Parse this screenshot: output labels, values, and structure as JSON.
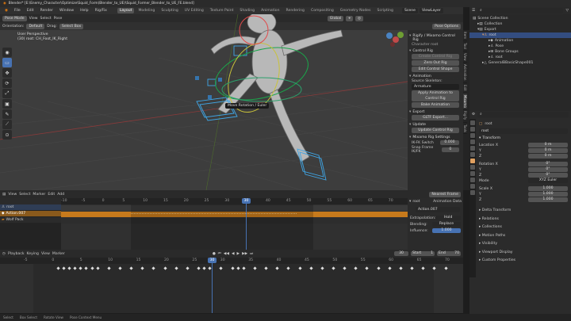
{
  "title_bar": {
    "app_title": "Blender* [E:\\Enemy_Character\\Optimize\\Squid_Form(Blender_to_UE)\\Squid_Former_Blender_to_UE_FE.blend]"
  },
  "menu": [
    "File",
    "Edit",
    "Render",
    "Window",
    "Help",
    "Rig/Fix"
  ],
  "workspaces": [
    {
      "label": "Layout",
      "active": true
    },
    {
      "label": "Modeling",
      "active": false
    },
    {
      "label": "Sculpting",
      "active": false
    },
    {
      "label": "UV Editing",
      "active": false
    },
    {
      "label": "Texture Paint",
      "active": false
    },
    {
      "label": "Shading",
      "active": false
    },
    {
      "label": "Animation",
      "active": false
    },
    {
      "label": "Rendering",
      "active": false
    },
    {
      "label": "Compositing",
      "active": false
    },
    {
      "label": "Geometry Nodes",
      "active": false
    },
    {
      "label": "Scripting",
      "active": false
    }
  ],
  "scene_field": "Scene",
  "viewlayer_field": "ViewLayer",
  "viewport": {
    "mode": "Pose Mode",
    "menus": [
      "View",
      "Select",
      "Pose"
    ],
    "orientation_label": "Orientation:",
    "orientation_value": "Default",
    "drag_label": "Drag:",
    "drag_value": "Select Box",
    "pivot": "Global",
    "pose_options": "Pose Options",
    "overlay_text_1": "User Perspective",
    "overlay_text_2": "(30) root: CH_Foot_IK_Right",
    "tooltip": "Move Rotation / Euler",
    "tool_icons": [
      "◉",
      "▭",
      "✥",
      "⟳",
      "⤢",
      "▣",
      "✎",
      "⟋",
      "⊙"
    ]
  },
  "npanel": {
    "title": "Rigify / Mixamo Control Rig",
    "character_root_label": "Character root",
    "sections": {
      "control_rig": "Control Rig",
      "animation": "Animation",
      "export": "Export",
      "update": "Update",
      "settings": "Mixamo Rig Settings"
    },
    "buttons": {
      "create": "Create Control Rig",
      "zero_out": "Zero Out Rig",
      "edit_shape": "Edit Control Shape",
      "apply_anim": "Apply Animation to Control Rig",
      "bake": "Bake Animation",
      "export": "GLTF Export...",
      "update": "Update Control Rig"
    },
    "source_skeleton_label": "Source Skeleton:",
    "source_skeleton_value": "Armature",
    "ik_fk_label": "IK-FK Switch",
    "ik_fk_value": "0.000",
    "snap_label": "Snap Frame IK/FK",
    "snap_value": "0"
  },
  "side_tabs": [
    "Item",
    "Tool",
    "View",
    "Animation",
    "Edit",
    "Mixamo",
    "Rigify",
    "Tools"
  ],
  "outliner": {
    "header": "Scene Collection",
    "items": [
      {
        "label": "Scene Collection",
        "indent": 0,
        "selected": false
      },
      {
        "label": "Collection",
        "indent": 1,
        "selected": false
      },
      {
        "label": "Export",
        "indent": 1,
        "selected": false
      },
      {
        "label": "root",
        "indent": 2,
        "selected": true
      },
      {
        "label": "Animation",
        "indent": 3,
        "selected": false
      },
      {
        "label": "Pose",
        "indent": 3,
        "selected": false
      },
      {
        "label": "Bone Groups",
        "indent": 3,
        "selected": false
      },
      {
        "label": "root",
        "indent": 3,
        "selected": false
      },
      {
        "label": "GeneralBBasicShape001",
        "indent": 2,
        "selected": false
      }
    ]
  },
  "properties": {
    "object_name": "root",
    "object_field": "root",
    "transform_header": "Transform",
    "location_label": "Location X",
    "rotation_label": "Rotation X",
    "scale_label": "Scale X",
    "axis_y": "Y",
    "axis_z": "Z",
    "loc": [
      "0 m",
      "0 m",
      "0 m"
    ],
    "rot": [
      "0°",
      "0°",
      "0°"
    ],
    "mode_label": "Mode",
    "mode_value": "XYZ Euler",
    "scale": [
      "1.000",
      "1.000",
      "1.000"
    ],
    "collapsed": [
      "Delta Transform",
      "Relations",
      "Collections",
      "Motion Paths",
      "Visibility",
      "Viewport Display",
      "Custom Properties"
    ]
  },
  "dopesheet": {
    "menus": [
      "View",
      "Select",
      "Marker",
      "Edit",
      "Add"
    ],
    "channels": [
      {
        "label": "root",
        "type": "object"
      },
      {
        "label": "Action.007",
        "type": "action"
      },
      {
        "label": "Wolf Pack",
        "type": "strip"
      }
    ],
    "ruler": [
      "-10",
      "-5",
      "0",
      "5",
      "10",
      "15",
      "20",
      "25",
      "30",
      "35",
      "40",
      "45",
      "50",
      "55",
      "60",
      "65",
      "70"
    ],
    "current_frame": "30",
    "interp": "Nearest Frame",
    "action_name": "Action.007",
    "anim_data": "Animation Data",
    "extrapolation_label": "Extrapolation:",
    "extrapolation_value": "Hold",
    "blending_label": "Blending:",
    "blending_value": "Replace",
    "influence_label": "Influence:",
    "influence_value": "1.000"
  },
  "timeline": {
    "menus": [
      "Playback",
      "Keying",
      "View",
      "Marker"
    ],
    "ruler": [
      "-5",
      "0",
      "5",
      "10",
      "15",
      "20",
      "25",
      "30",
      "35",
      "40",
      "45",
      "50",
      "55",
      "60",
      "65",
      "70"
    ],
    "current_frame": "30",
    "frame_field": "30",
    "start_label": "Start",
    "start_value": "1",
    "end_label": "End",
    "end_value": "70",
    "transport": [
      "⏮",
      "◀◀",
      "◀",
      "▶",
      "▶▶",
      "⏭"
    ]
  },
  "statusbar": [
    "Select",
    "Box Select",
    "Rotate View",
    "Pose Context Menu"
  ],
  "colors": {
    "accent": "#4772b3",
    "orange": "#c77a1c",
    "selected_row": "#334d80"
  }
}
